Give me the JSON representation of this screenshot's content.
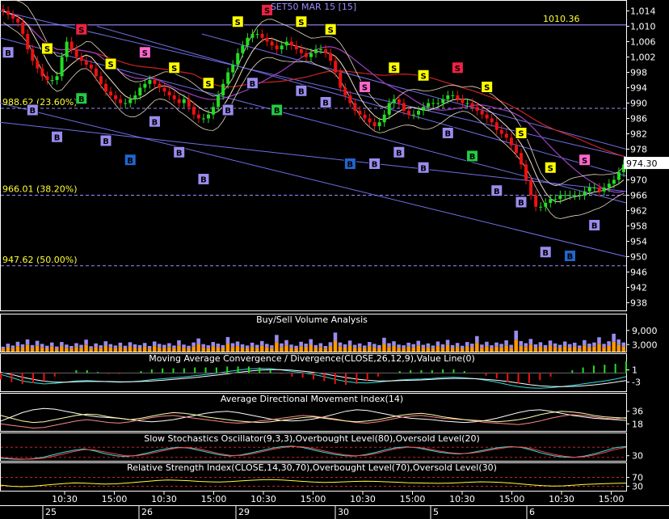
{
  "chart_data": {
    "type": "candlestick",
    "title": "SET50 MAR 15  [15]",
    "price_axis": {
      "ylim": [
        936,
        1016
      ],
      "ticks": [
        "1,014",
        "1,010",
        "1,006",
        "1,002",
        "998",
        "994",
        "990",
        "986",
        "982",
        "978",
        "974",
        "970",
        "966",
        "962",
        "958",
        "954",
        "950",
        "946",
        "942",
        "938"
      ],
      "tick_values": [
        1014,
        1010,
        1006,
        1002,
        998,
        994,
        990,
        986,
        982,
        978,
        974,
        970,
        966,
        962,
        958,
        954,
        950,
        946,
        942,
        938
      ]
    },
    "horizontal_levels": [
      {
        "label": "1010.36",
        "value": 1010.36,
        "color": "#9a8cff"
      },
      {
        "label": "988.62 (23.60%)",
        "value": 988.62,
        "color": "#9a8cff"
      },
      {
        "label": "966.01 (38.20%)",
        "value": 966.01,
        "color": "#9a8cff"
      },
      {
        "label": "947.62 (50.00%)",
        "value": 947.62,
        "color": "#9a8cff"
      }
    ],
    "last_price": {
      "label": "974.30",
      "value": 974.3
    },
    "close": [
      1014,
      1013,
      1012,
      1011,
      1008,
      1004,
      1001,
      999,
      997,
      996,
      996,
      997,
      1002,
      1006,
      1004,
      1002,
      1001,
      1000,
      999,
      997,
      995,
      993,
      992,
      991,
      990,
      990,
      991,
      992,
      994,
      995,
      996,
      995,
      994,
      993,
      992,
      991,
      990,
      991,
      989,
      987,
      986,
      986,
      987,
      989,
      992,
      995,
      998,
      1000,
      1003,
      1005,
      1007,
      1008,
      1008,
      1007,
      1006,
      1005,
      1004,
      1005,
      1006,
      1005,
      1004,
      1003,
      1002,
      1003,
      1004,
      1004,
      1003,
      1001,
      998,
      994,
      992,
      990,
      988,
      987,
      986,
      985,
      984,
      985,
      987,
      990,
      991,
      990,
      988,
      987,
      987,
      988,
      989,
      990,
      990,
      990,
      991,
      992,
      992,
      991,
      990,
      990,
      989,
      988,
      987,
      986,
      985,
      983,
      982,
      981,
      979,
      977,
      974,
      970,
      966,
      963,
      963,
      964,
      965,
      965,
      966,
      966,
      966,
      966,
      966,
      967,
      968,
      968,
      967,
      968,
      969,
      970,
      972,
      974
    ],
    "volume_panel": {
      "title": "Buy/Sell Volume Analysis",
      "ticks": [
        "9,000",
        "3,000"
      ],
      "tick_values": [
        9000,
        3000
      ],
      "ylim": [
        0,
        12000
      ]
    },
    "volume": [
      2100,
      3400,
      2600,
      4200,
      3100,
      5200,
      2800,
      4600,
      3300,
      2500,
      3900,
      2200,
      4100,
      3000,
      2400,
      3600,
      2900,
      5100,
      2300,
      3500,
      2700,
      4400,
      3200,
      2600,
      3800,
      2500,
      4000,
      3100,
      2800,
      3700,
      2400,
      4300,
      3300,
      2900,
      3600,
      2600,
      4800,
      3000,
      2500,
      3900,
      5600,
      3200,
      2700,
      4100,
      3400,
      2800,
      6200,
      3600,
      4300,
      3100,
      2600,
      3800,
      2900,
      4500,
      3300,
      2700,
      7100,
      3500,
      4900,
      3000,
      2500,
      4200,
      3400,
      5300,
      2800,
      3600,
      2400,
      4000,
      8100,
      3900,
      3100,
      4700,
      2900,
      3500,
      2600,
      4100,
      3300,
      2800,
      5900,
      3600,
      4400,
      3000,
      2700,
      3800,
      3200,
      4600,
      2900,
      3500,
      2600,
      4300,
      3100,
      5000,
      2800,
      3700,
      2500,
      4100,
      3400,
      6600,
      3000,
      4200,
      2700,
      3900,
      3300,
      4800,
      2900,
      8900,
      4500,
      3600,
      5400,
      3100,
      4000,
      2800,
      4700,
      3500,
      2900,
      4300,
      3200,
      3800,
      2600,
      4900,
      3400,
      3900,
      6100,
      3300,
      4400,
      7600,
      5200,
      3900
    ],
    "macd_panel": {
      "title": "Moving Average Convergence / Divergence(CLOSE,26,12,9),Value Line(0)",
      "ticks": [
        "1",
        "-3"
      ],
      "tick_values": [
        1,
        -3
      ],
      "ylim": [
        -6,
        3
      ],
      "series": [
        {
          "values": [
            -0.5,
            -1.5,
            -2.6,
            -3.2,
            -3.6,
            -3.4,
            -3,
            -2.6,
            -2.5,
            -2.7,
            -2.9,
            -3,
            -2.9,
            -2.6,
            -2.2,
            -1.9,
            -1.6,
            -1.3,
            -0.9,
            -0.5,
            -0.1,
            0.4,
            0.9,
            1.3,
            1.5,
            1.4,
            1,
            0.5,
            0.1,
            -0.5,
            -1.2,
            -2.1,
            -2.8,
            -3.2,
            -3.3,
            -3,
            -2.6,
            -2.3,
            -2.1,
            -2,
            -1.8,
            -1.5,
            -1.4,
            -1.6,
            -1.9,
            -2.4,
            -3,
            -3.8,
            -4.5,
            -4.9,
            -5,
            -4.8,
            -4.5,
            -4.1,
            -3.6,
            -3.1,
            -2.6,
            -2,
            -1.2
          ]
        },
        {
          "values": [
            0.2,
            -0.5,
            -1.4,
            -2.1,
            -2.7,
            -3,
            -3,
            -2.9,
            -2.8,
            -2.8,
            -2.8,
            -2.9,
            -2.9,
            -2.8,
            -2.6,
            -2.4,
            -2.1,
            -1.8,
            -1.5,
            -1.1,
            -0.7,
            -0.3,
            0.2,
            0.6,
            0.9,
            1.1,
            1.1,
            0.9,
            0.6,
            0.2,
            -0.3,
            -0.9,
            -1.5,
            -2,
            -2.4,
            -2.6,
            -2.6,
            -2.5,
            -2.4,
            -2.3,
            -2.1,
            -1.9,
            -1.8,
            -1.8,
            -1.9,
            -2.1,
            -2.4,
            -2.8,
            -3.3,
            -3.8,
            -4.2,
            -4.4,
            -4.5,
            -4.4,
            -4.2,
            -3.9,
            -3.5,
            -3,
            -2.5
          ]
        }
      ]
    },
    "adx_panel": {
      "title": "Average Directional Movement Index(14)",
      "ticks": [
        "36",
        "18"
      ],
      "tick_values": [
        36,
        18
      ],
      "ylim": [
        8,
        46
      ],
      "series": [
        {
          "values": [
            22,
            28,
            34,
            38,
            40,
            39,
            36,
            33,
            30,
            28,
            27,
            26,
            24,
            22,
            21,
            22,
            24,
            27,
            30,
            33,
            35,
            36,
            34,
            31,
            28,
            25,
            23,
            22,
            23,
            25,
            28,
            32,
            36,
            38,
            37,
            34,
            31,
            28,
            26,
            25,
            24,
            22,
            21,
            20,
            21,
            23,
            26,
            30,
            34,
            37,
            38,
            36,
            33,
            30,
            28,
            26,
            25,
            24,
            23
          ]
        },
        {
          "values": [
            18,
            16,
            14,
            12,
            13,
            16,
            19,
            22,
            24,
            22,
            20,
            19,
            21,
            24,
            27,
            29,
            30,
            28,
            26,
            24,
            22,
            20,
            19,
            20,
            22,
            24,
            26,
            28,
            30,
            29,
            27,
            25,
            22,
            20,
            19,
            21,
            24,
            27,
            29,
            30,
            28,
            26,
            25,
            24,
            22,
            20,
            19,
            18,
            17,
            19,
            22,
            26,
            29,
            31,
            30,
            28,
            26,
            25,
            27
          ]
        },
        {
          "values": [
            30,
            26,
            22,
            20,
            21,
            24,
            27,
            30,
            32,
            31,
            28,
            26,
            24,
            26,
            29,
            32,
            34,
            33,
            31,
            28,
            26,
            24,
            22,
            21,
            20,
            21,
            23,
            25,
            27,
            28,
            26,
            24,
            22,
            21,
            22,
            24,
            27,
            30,
            32,
            33,
            31,
            28,
            26,
            24,
            23,
            22,
            21,
            22,
            24,
            27,
            31,
            34,
            36,
            35,
            33,
            30,
            28,
            27,
            26
          ]
        }
      ]
    },
    "stoch_panel": {
      "title": "Slow Stochastics Oscillator(9,3,3),Overbought Level(80),Oversold Level(20)",
      "ticks": [
        "30"
      ],
      "tick_values": [
        30
      ],
      "ylim": [
        0,
        100
      ],
      "levels": [
        80,
        20
      ],
      "series": [
        {
          "values": [
            15,
            10,
            8,
            12,
            20,
            35,
            50,
            62,
            70,
            58,
            42,
            30,
            25,
            32,
            45,
            60,
            72,
            80,
            75,
            62,
            48,
            35,
            28,
            34,
            46,
            60,
            74,
            84,
            86,
            78,
            64,
            50,
            38,
            30,
            28,
            36,
            50,
            66,
            78,
            82,
            76,
            64,
            52,
            44,
            40,
            46,
            58,
            70,
            80,
            84,
            78,
            62,
            44,
            30,
            22,
            20,
            28,
            42,
            60,
            78,
            84
          ]
        },
        {
          "values": [
            20,
            14,
            10,
            10,
            15,
            26,
            40,
            55,
            66,
            64,
            52,
            40,
            30,
            30,
            38,
            52,
            65,
            76,
            78,
            70,
            56,
            42,
            32,
            31,
            40,
            53,
            66,
            78,
            84,
            82,
            72,
            58,
            45,
            35,
            30,
            32,
            43,
            58,
            72,
            80,
            79,
            70,
            58,
            48,
            43,
            44,
            52,
            64,
            74,
            82,
            81,
            70,
            54,
            38,
            27,
            21,
            24,
            35,
            50,
            68,
            80
          ]
        }
      ]
    },
    "rsi_panel": {
      "title": "Relative Strength Index(CLOSE,14,30,70),Overbought Level(70),Oversold Level(30)",
      "ticks": [
        "70",
        "30"
      ],
      "tick_values": [
        70,
        30
      ],
      "ylim": [
        10,
        90
      ],
      "levels": [
        70,
        30
      ],
      "series": [
        {
          "values": [
            35,
            30,
            28,
            30,
            34,
            38,
            42,
            45,
            44,
            42,
            40,
            41,
            44,
            48,
            52,
            56,
            58,
            57,
            55,
            52,
            50,
            49,
            51,
            54,
            57,
            59,
            60,
            58,
            55,
            52,
            49,
            47,
            48,
            50,
            52,
            53,
            52,
            50,
            48,
            46,
            45,
            44,
            43,
            44,
            46,
            48,
            50,
            49,
            47,
            44,
            40,
            36,
            33,
            31,
            32,
            35,
            38,
            40,
            42,
            43,
            44
          ]
        }
      ]
    },
    "x_axis": {
      "time_ticks": [
        "10:30",
        "15:00",
        "10:30",
        "15:00",
        "10:30",
        "15:00",
        "10:30",
        "15:00",
        "10:30",
        "15:00",
        "10:30",
        "15:00"
      ],
      "date_ticks": [
        "25",
        "26",
        "29",
        "30",
        "5",
        "6"
      ]
    },
    "signals": {
      "buy_label": "B",
      "sell_label": "S",
      "buy_count": 25,
      "sell_count": 19
    }
  }
}
